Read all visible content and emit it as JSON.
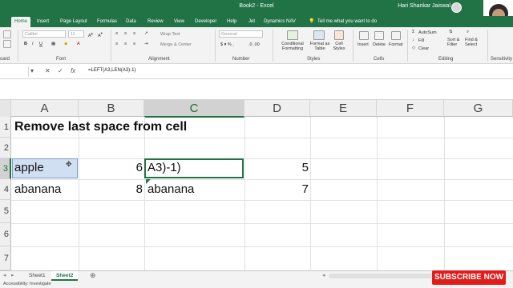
{
  "window": {
    "title": "Book2 - Excel",
    "user": "Hari Shankar Jaiswal",
    "controls": [
      "—",
      "▢",
      "✕"
    ]
  },
  "menu": {
    "tabs": [
      "Home",
      "Insert",
      "Page Layout",
      "Formulas",
      "Data",
      "Review",
      "View",
      "Developer",
      "Help",
      "Jet",
      "Dynamics NAV"
    ],
    "active": "Home",
    "tell_me": "Tell me what you want to do"
  },
  "ribbon": {
    "groups": {
      "clipboard": "oard",
      "font": "Font",
      "alignment": "Alignment",
      "number": "Number",
      "styles": "Styles",
      "cells": "Cells",
      "editing": "Editing",
      "sensitivity": "Sensitivity"
    },
    "font_name": "Calibri",
    "font_size": "11",
    "wrap_text": "Wrap Text",
    "merge_center": "Merge & Center",
    "number_format": "General",
    "conditional_formatting": "Conditional\nFormatting",
    "format_as_table": "Format as\nTable",
    "cell_styles": "Cell\nStyles",
    "insert": "Insert",
    "delete": "Delete",
    "format": "Format",
    "autosum": "AutoSum",
    "fill": "Fill",
    "clear": "Clear",
    "sort_filter": "Sort &\nFilter",
    "find_select": "Find &\nSelect",
    "sensitivity_btn": "Sensitivity"
  },
  "formula_bar": {
    "formula": "=LEFT(A3,LEN(A3)-1)"
  },
  "columns": [
    "A",
    "B",
    "C",
    "D",
    "E",
    "F",
    "G"
  ],
  "selected_column": "C",
  "rows": [
    "1",
    "2",
    "3",
    "4",
    "5",
    "6",
    "7"
  ],
  "selected_row": "3",
  "cells": {
    "heading": "Remove last space from cell",
    "a3": "apple",
    "b3": "6",
    "c3": "A3)-1)",
    "d3": "5",
    "a4": "abanana",
    "b4": "8",
    "c4": "abanana",
    "d4": "7"
  },
  "sheets": [
    "Sheet1",
    "Sheet2"
  ],
  "active_sheet": "Sheet2",
  "status": {
    "accessibility": "Accessibility: Investigate"
  },
  "overlay": {
    "subscribe": "SUBSCRIBE NOW"
  },
  "colors": {
    "excel_green": "#217346",
    "selection_blue": "#d0dff2",
    "subscribe_red": "#e21b1b"
  }
}
